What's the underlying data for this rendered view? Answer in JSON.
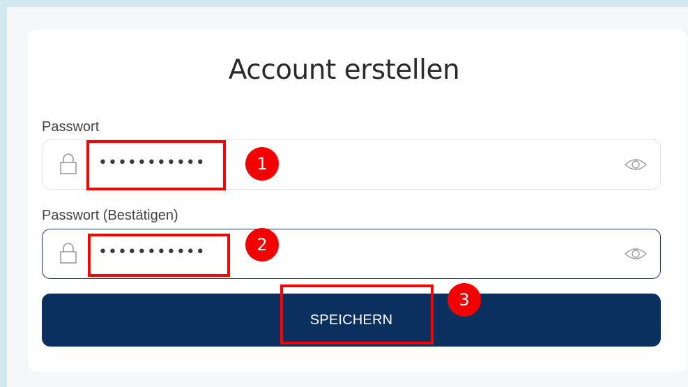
{
  "form": {
    "title": "Account erstellen",
    "password_label": "Passwort",
    "password_value": "•••••••••••",
    "confirm_label": "Passwort (Bestätigen)",
    "confirm_value": "•••••••••••",
    "save_label": "SPEICHERN"
  },
  "annotations": {
    "step1": "1",
    "step2": "2",
    "step3": "3"
  },
  "colors": {
    "background": "#d3e9f1",
    "button": "#0a3060",
    "highlight": "#ff0000",
    "focus_border": "#1f3b63"
  },
  "icons": {
    "lock": "lock-icon",
    "eye": "eye-icon"
  }
}
